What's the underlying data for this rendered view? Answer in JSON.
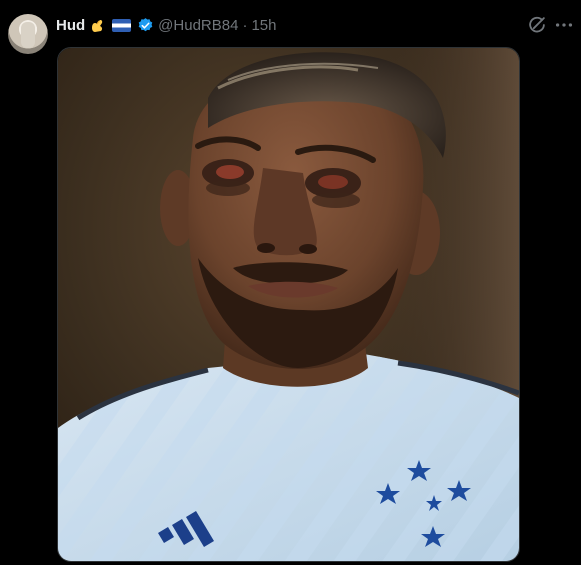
{
  "post": {
    "author_name": "Hud",
    "handle": "@HudRB84",
    "separator": "·",
    "timestamp": "15h",
    "verified": true,
    "emoji_badges": [
      "flexed-arm-emoji",
      "flag-emoji"
    ]
  },
  "icons": {
    "grok": "grok-icon",
    "more": "more-icon"
  },
  "colors": {
    "background": "#000000",
    "text_primary": "#e7e9ea",
    "text_secondary": "#71767b",
    "verified": "#1d9bf0"
  }
}
